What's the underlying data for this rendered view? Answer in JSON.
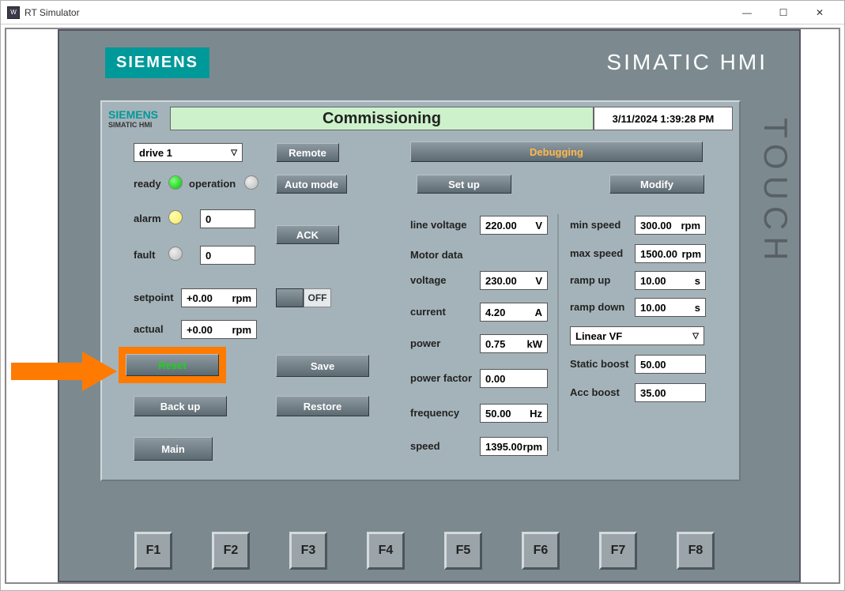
{
  "window": {
    "title": "RT Simulator"
  },
  "header": {
    "siemens": "SIEMENS",
    "product": "SIMATIC HMI",
    "touch": "TOUCH"
  },
  "panel": {
    "brand1": "SIEMENS",
    "brand2": "SIMATIC HMI",
    "title": "Commissioning",
    "datetime": "3/11/2024 1:39:28 PM"
  },
  "drive_selector": {
    "value": "drive 1"
  },
  "remote_btn": "Remote",
  "auto_mode_btn": "Auto mode",
  "ack_btn": "ACK",
  "status": {
    "ready_label": "ready",
    "operation_label": "operation",
    "alarm_label": "alarm",
    "alarm_value": "0",
    "fault_label": "fault",
    "fault_value": "0"
  },
  "setpoint": {
    "label": "setpoint",
    "value": "+0.00",
    "unit": "rpm"
  },
  "actual": {
    "label": "actual",
    "value": "+0.00",
    "unit": "rpm"
  },
  "toggle": {
    "off": "OFF"
  },
  "buttons": {
    "reset": "Reset",
    "save": "Save",
    "backup": "Back up",
    "restore": "Restore",
    "main": "Main",
    "debugging": "Debugging",
    "setup": "Set up",
    "modify": "Modify"
  },
  "motor": {
    "line_voltage_label": "line voltage",
    "line_voltage": "220.00",
    "line_voltage_unit": "V",
    "heading": "Motor data",
    "voltage_label": "voltage",
    "voltage": "230.00",
    "voltage_unit": "V",
    "current_label": "current",
    "current": "4.20",
    "current_unit": "A",
    "power_label": "power",
    "power": "0.75",
    "power_unit": "kW",
    "pf_label": "power factor",
    "pf": "0.00",
    "freq_label": "frequency",
    "freq": "50.00",
    "freq_unit": "Hz",
    "speed_label": "speed",
    "speed": "1395.00",
    "speed_unit": "rpm"
  },
  "right": {
    "minspeed_label": "min speed",
    "minspeed": "300.00",
    "minspeed_unit": "rpm",
    "maxspeed_label": "max speed",
    "maxspeed": "1500.00",
    "maxspeed_unit": "rpm",
    "rampup_label": "ramp up",
    "rampup": "10.00",
    "rampup_unit": "s",
    "rampdown_label": "ramp down",
    "rampdown": "10.00",
    "rampdown_unit": "s",
    "vf_mode": "Linear VF",
    "static_boost_label": "Static boost",
    "static_boost": "50.00",
    "acc_boost_label": "Acc boost",
    "acc_boost": "35.00"
  },
  "fkeys": [
    "F1",
    "F2",
    "F3",
    "F4",
    "F5",
    "F6",
    "F7",
    "F8"
  ]
}
